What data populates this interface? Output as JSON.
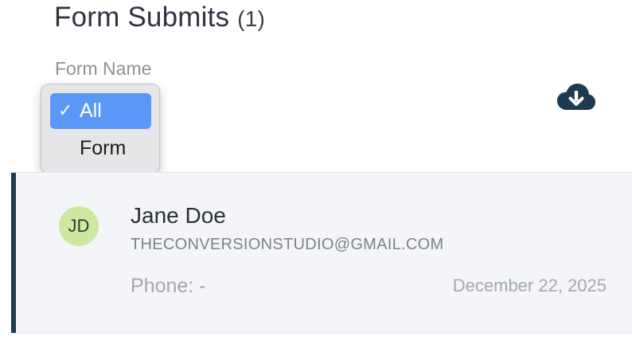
{
  "header": {
    "title": "Form Submits",
    "count": "(1)",
    "filter_label": "Form Name"
  },
  "toolbar": {
    "download_icon": "cloud-download-icon"
  },
  "form_filter": {
    "selected_index": 0,
    "options": [
      {
        "label": "All",
        "check": "✓",
        "selected": true
      },
      {
        "label": "Form",
        "selected": false
      }
    ]
  },
  "submissions": [
    {
      "initials": "JD",
      "name": "Jane Doe",
      "email": "THECONVERSIONSTUDIO@GMAIL.COM",
      "phone": "Phone: -",
      "date": "December 22, 2025"
    }
  ],
  "colors": {
    "accent_bar": "#1d3a4e",
    "avatar_bg": "#cfe8a1",
    "selected_option": "#5b97f7",
    "card_bg": "#f4f5f9"
  }
}
